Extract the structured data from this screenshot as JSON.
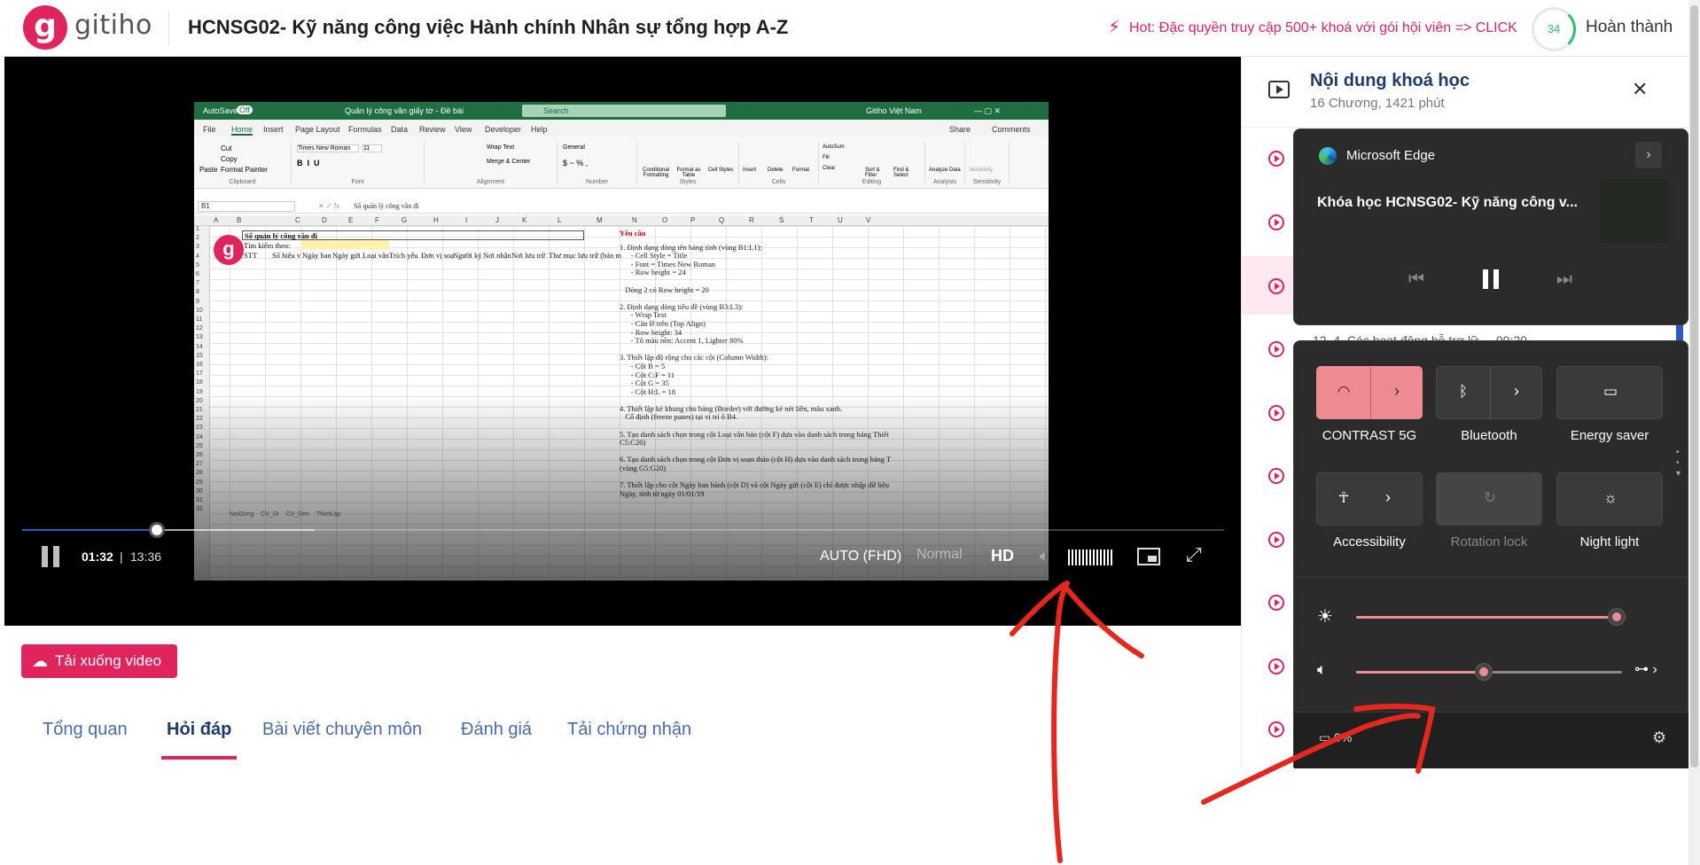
{
  "header": {
    "logo_letter": "g",
    "brand": "gitiho",
    "course_title": "HCNSG02- Kỹ năng công việc Hành chính Nhân sự tổng hợp A-Z",
    "hot_text": "Hot: Đặc quyền truy cập 500+ khoá với gói hội viên => CLICK",
    "progress_value": "34",
    "complete_label": "Hoàn thành",
    "colors": {
      "brand": "#e0245e",
      "progress": "#2fbf71"
    }
  },
  "excel": {
    "autosave": "AutoSave",
    "autosave_state": "Off",
    "file_title": "Quản lý công văn giấy tờ - Đề bài",
    "search": "Search",
    "account": "Gitiho Việt Nam",
    "menu": [
      "File",
      "Home",
      "Insert",
      "Page Layout",
      "Formulas",
      "Data",
      "Review",
      "View",
      "Developer",
      "Help"
    ],
    "share": "Share",
    "comments": "Comments",
    "ribbon_groups": [
      "Clipboard",
      "Font",
      "Alignment",
      "Number",
      "Styles",
      "Cells",
      "Editing",
      "Analysis",
      "Sensitivity"
    ],
    "ribbon_items": {
      "cut": "Cut",
      "copy": "Copy",
      "format_painter": "Format Painter",
      "paste": "Paste",
      "font_name": "Times New Roman",
      "font_size": "11",
      "wrap_text": "Wrap Text",
      "merge_center": "Merge & Center",
      "general": "General",
      "conditional": "Conditional Formatting",
      "format_table": "Format as Table",
      "cell_styles": "Cell Styles",
      "insert": "Insert",
      "delete": "Delete",
      "format": "Format",
      "autosum": "AutoSum",
      "fill": "Fill",
      "clear": "Clear",
      "sort_filter": "Sort & Filter",
      "find_select": "Find & Select",
      "analyze": "Analyze Data",
      "sensitivity": "Sensitivity"
    },
    "name_box": "B1",
    "formula_text": "Sổ quản lý công văn đi",
    "columns": [
      "A",
      "B",
      "C",
      "D",
      "E",
      "F",
      "G",
      "H",
      "I",
      "J",
      "K",
      "L",
      "M",
      "N",
      "O",
      "P",
      "Q",
      "R",
      "S",
      "T",
      "U",
      "V"
    ],
    "rows": [
      "1",
      "2",
      "3",
      "4",
      "5",
      "6",
      "7",
      "8",
      "9",
      "10",
      "11",
      "12",
      "13",
      "14",
      "15",
      "16",
      "17",
      "18",
      "19",
      "20",
      "21",
      "22",
      "23",
      "24",
      "25",
      "26",
      "27",
      "28",
      "29",
      "30",
      "31",
      "32"
    ],
    "cell_b1": "Sổ quản lý công văn đi",
    "cell_b2": "Tìm kiếm theo:",
    "headers_row3": [
      "STT",
      "Số hiệu v",
      "Ngày ban",
      "Ngày gửi",
      "Loại văn",
      "Trích yếu",
      "Đơn vị soạ",
      "Người ký",
      "Nơi nhận",
      "Nơi lưu trữ",
      "Thư mục lưu trữ (bản m"
    ],
    "requirement_title": "Yêu cầu",
    "requirements": [
      "1. Định dạng dòng tên bảng tính (vùng B1:L1):",
      "      - Cell Style = Title",
      "      - Font = Times New Roman",
      "      - Row height = 24",
      "",
      "   Dòng 2 có Row height = 20",
      "",
      "2. Định dạng dòng tiêu đề (vùng B3:L3):",
      "      - Wrap Text",
      "      - Căn lề trên (Top Align)",
      "      - Row height: 34",
      "      - Tô màu nền: Accent 1, Lighter 80%",
      "",
      "3. Thiết lập độ rộng cho các cột (Column Width):",
      "      - Cột B = 5",
      "      - Cột C:F = 11",
      "      - Cột G = 35",
      "      - Cột H:L = 18",
      "",
      "4. Thiết lập kẻ khung cho bảng (Border) với đường kẻ nét liền, màu xanh.",
      "   Cố định (freeze panes) tại vị trí ô B4.",
      "",
      "5. Tạo danh sách chọn trong cột Loại văn bản (cột F) dựa vào danh sách trong bảng Thiết",
      "C5:C20)",
      "",
      "6. Tạo danh sách chọn trong cột Đơn vị soạn thảo (cột H) dựa vào danh sách trong bảng T",
      "(vùng G5:G20)",
      "",
      "7. Thiết lập cho cột Ngày ban hành (cột D) và cột Ngày gửi (cột E) chỉ được nhập dữ liệu",
      "Ngày, tính từ ngày 01/01/19"
    ],
    "sheet_tabs": [
      "NoiDung",
      "CV_Di",
      "CV_Den",
      "ThietLap"
    ]
  },
  "player": {
    "current_time": "01:32",
    "separator": "|",
    "total_time": "13:36",
    "played_fraction": 0.112,
    "quality": "AUTO (FHD)",
    "speed": "Normal",
    "hd": "HD",
    "colors": {
      "played": "#2a5ac8"
    }
  },
  "below_video": {
    "download_label": "Tải xuống video",
    "tabs": [
      "Tổng quan",
      "Hỏi đáp",
      "Bài viết chuyên môn",
      "Đánh giá",
      "Tải chứng nhận"
    ],
    "active_tab": 1
  },
  "sidebar": {
    "title": "Nội dung khoá học",
    "subtitle": "16 Chương, 1421 phút",
    "lesson_peek": "12. 4. Các hoạt động hỗ trợ lữ ... 00:20"
  },
  "media_flyout": {
    "app": "Microsoft Edge",
    "media_title": "Khóa học HCNSG02- Kỹ năng công v..."
  },
  "quick_settings": {
    "tiles": [
      {
        "label": "CONTRAST 5G",
        "icon": "wifi-icon",
        "state": "on",
        "has_arrow": true
      },
      {
        "label": "Bluetooth",
        "icon": "bluetooth-icon",
        "state": "normal",
        "has_arrow": true
      },
      {
        "label": "Energy saver",
        "icon": "battery-saver-icon",
        "state": "normal",
        "has_arrow": false
      },
      {
        "label": "Accessibility",
        "icon": "accessibility-icon",
        "state": "normal",
        "has_arrow": true
      },
      {
        "label": "Rotation lock",
        "icon": "rotation-lock-icon",
        "state": "disabled",
        "has_arrow": false
      },
      {
        "label": "Night light",
        "icon": "night-light-icon",
        "state": "normal",
        "has_arrow": false
      }
    ],
    "brightness_fraction": 0.98,
    "volume_fraction": 0.48,
    "battery_text": "0%",
    "colors": {
      "accent": "#ee8a91"
    }
  }
}
